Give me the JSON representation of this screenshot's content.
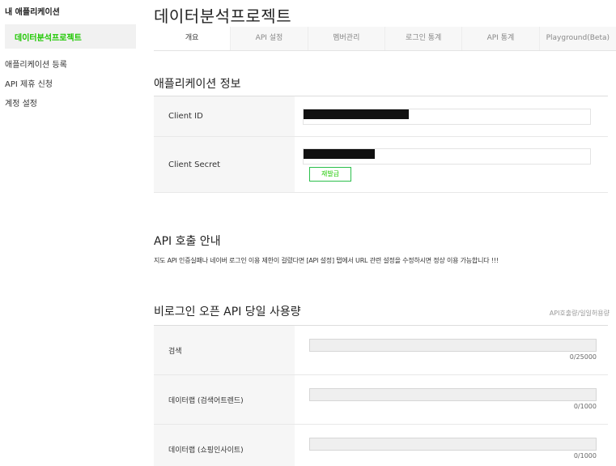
{
  "sidebar": {
    "title": "내 애플리케이션",
    "active_app": "데이터분석프로젝트",
    "links": [
      "애플리케이션 등록",
      "API 제휴 신청",
      "계정 설정"
    ]
  },
  "page_title": "데이터분석프로젝트",
  "tabs": [
    {
      "label": "개요",
      "active": true
    },
    {
      "label": "API 설정",
      "active": false
    },
    {
      "label": "멤버관리",
      "active": false
    },
    {
      "label": "로그인 통계",
      "active": false
    },
    {
      "label": "API 통계",
      "active": false
    },
    {
      "label": "Playground(Beta)",
      "active": false
    }
  ],
  "app_info": {
    "title": "애플리케이션 정보",
    "client_id_label": "Client ID",
    "client_secret_label": "Client Secret",
    "reissue_button": "재발급"
  },
  "api_call": {
    "title": "API 호출 안내",
    "notice": "지도 API 인증실패나 네이버 로그인 이용 제한이 걸렸다면 [API 설정] 탭에서 URL 관련 설정을 수정하시면 정상 이용 가능합니다 !!!"
  },
  "usage": {
    "title": "비로그인 오픈 API 당일 사용량",
    "caption": "API호출량/일일허용량",
    "rows": [
      {
        "label": "검색",
        "count": "0/25000",
        "fill": 0
      },
      {
        "label": "데이터랩 (검색어트렌드)",
        "count": "0/1000",
        "fill": 0
      },
      {
        "label": "데이터랩 (쇼핑인사이트)",
        "count": "0/1000",
        "fill": 0
      }
    ]
  },
  "colors": {
    "accent": "#1ec800",
    "button_border": "#2bbf4b",
    "label_bg": "#f6f6f6"
  }
}
